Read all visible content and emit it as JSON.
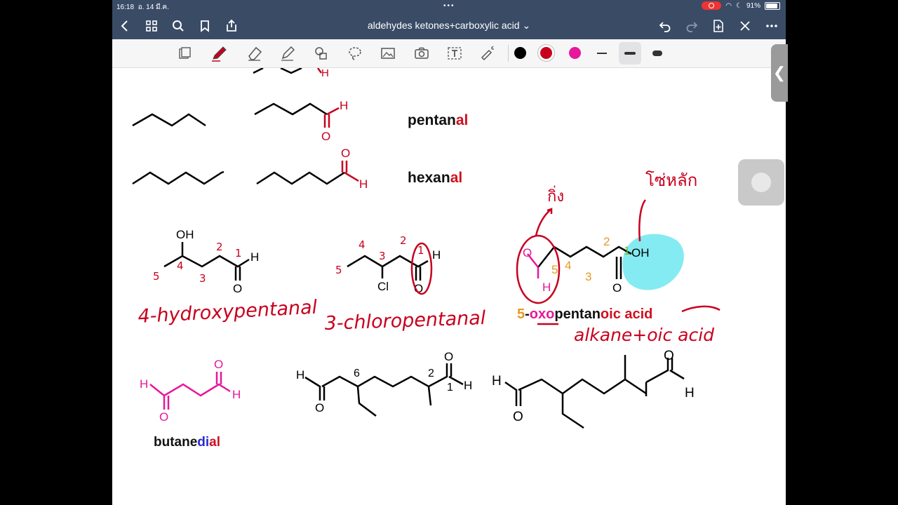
{
  "status": {
    "time": "16:18",
    "date": "อ. 14 มี.ค.",
    "dots": "•••",
    "battery": "91%"
  },
  "nav": {
    "title": "aldehydes ketones+carboxylic acid",
    "title_chevron": "⌄"
  },
  "toolbar": {
    "colors": [
      "#000000",
      "#c8001e",
      "#e6189b"
    ]
  },
  "typed": {
    "pentanal_a": "pentan",
    "pentanal_b": "al",
    "hexanal_a": "hexan",
    "hexanal_b": "al",
    "oxo_5": "5",
    "oxo_dash": "-",
    "oxo_oxo": "oxo",
    "oxo_pentan": "pentan",
    "oxo_oic": "oic acid",
    "butane": "butane",
    "butane_di": "di",
    "butane_al": "al"
  },
  "atoms": {
    "H": "H",
    "O": "O",
    "OH": "OH",
    "Cl": "Cl",
    "n1": "1",
    "n2": "2",
    "n3": "3",
    "n4": "4",
    "n5": "5",
    "n6": "6"
  },
  "handwriting": {
    "hydroxypentanal": "4-hydroxypentanal",
    "chloropentanal": "3-chloropentanal",
    "alkane_oic": "alkane+oic acid",
    "thai_1": "กิ่ง",
    "thai_2": "โซ่หลัก"
  }
}
